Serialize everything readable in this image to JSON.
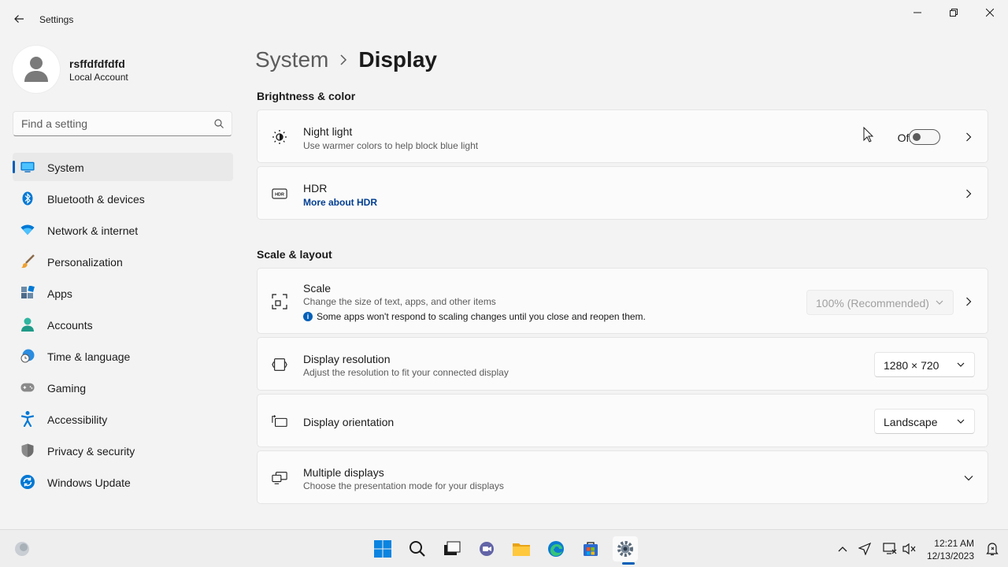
{
  "window": {
    "title": "Settings",
    "minimize_icon": "minimize-icon",
    "maximize_icon": "maximize-icon",
    "close_icon": "close-icon"
  },
  "profile": {
    "name": "rsffdfdfdfd",
    "account_type": "Local Account"
  },
  "search": {
    "placeholder": "Find a setting"
  },
  "sidebar": {
    "items": [
      {
        "label": "System",
        "icon": "monitor-icon",
        "active": true
      },
      {
        "label": "Bluetooth & devices",
        "icon": "bluetooth-icon"
      },
      {
        "label": "Network & internet",
        "icon": "wifi-icon"
      },
      {
        "label": "Personalization",
        "icon": "paintbrush-icon"
      },
      {
        "label": "Apps",
        "icon": "apps-icon"
      },
      {
        "label": "Accounts",
        "icon": "person-icon"
      },
      {
        "label": "Time & language",
        "icon": "globe-clock-icon"
      },
      {
        "label": "Gaming",
        "icon": "gamepad-icon"
      },
      {
        "label": "Accessibility",
        "icon": "accessibility-icon"
      },
      {
        "label": "Privacy & security",
        "icon": "shield-icon"
      },
      {
        "label": "Windows Update",
        "icon": "update-icon"
      }
    ]
  },
  "breadcrumb": {
    "parent": "System",
    "current": "Display"
  },
  "sections": {
    "brightness": "Brightness & color",
    "scale_layout": "Scale & layout"
  },
  "cards": {
    "night_light": {
      "title": "Night light",
      "subtitle": "Use warmer colors to help block blue light",
      "toggle_state": "Off"
    },
    "hdr": {
      "title": "HDR",
      "link": "More about HDR",
      "icon_text": "HDR"
    },
    "scale": {
      "title": "Scale",
      "subtitle": "Change the size of text, apps, and other items",
      "info": "Some apps won't respond to scaling changes until you close and reopen them.",
      "info_glyph": "i",
      "value": "100% (Recommended)"
    },
    "resolution": {
      "title": "Display resolution",
      "subtitle": "Adjust the resolution to fit your connected display",
      "value": "1280 × 720"
    },
    "orientation": {
      "title": "Display orientation",
      "value": "Landscape"
    },
    "multiple": {
      "title": "Multiple displays",
      "subtitle": "Choose the presentation mode for your displays"
    }
  },
  "taskbar": {
    "apps": [
      "start-icon",
      "search-icon",
      "task-view-icon",
      "chat-icon",
      "file-explorer-icon",
      "edge-icon",
      "store-icon",
      "settings-icon"
    ],
    "time": "12:21 AM",
    "date": "12/13/2023"
  },
  "colors": {
    "accent": "#005fb8",
    "link": "#003e92"
  }
}
